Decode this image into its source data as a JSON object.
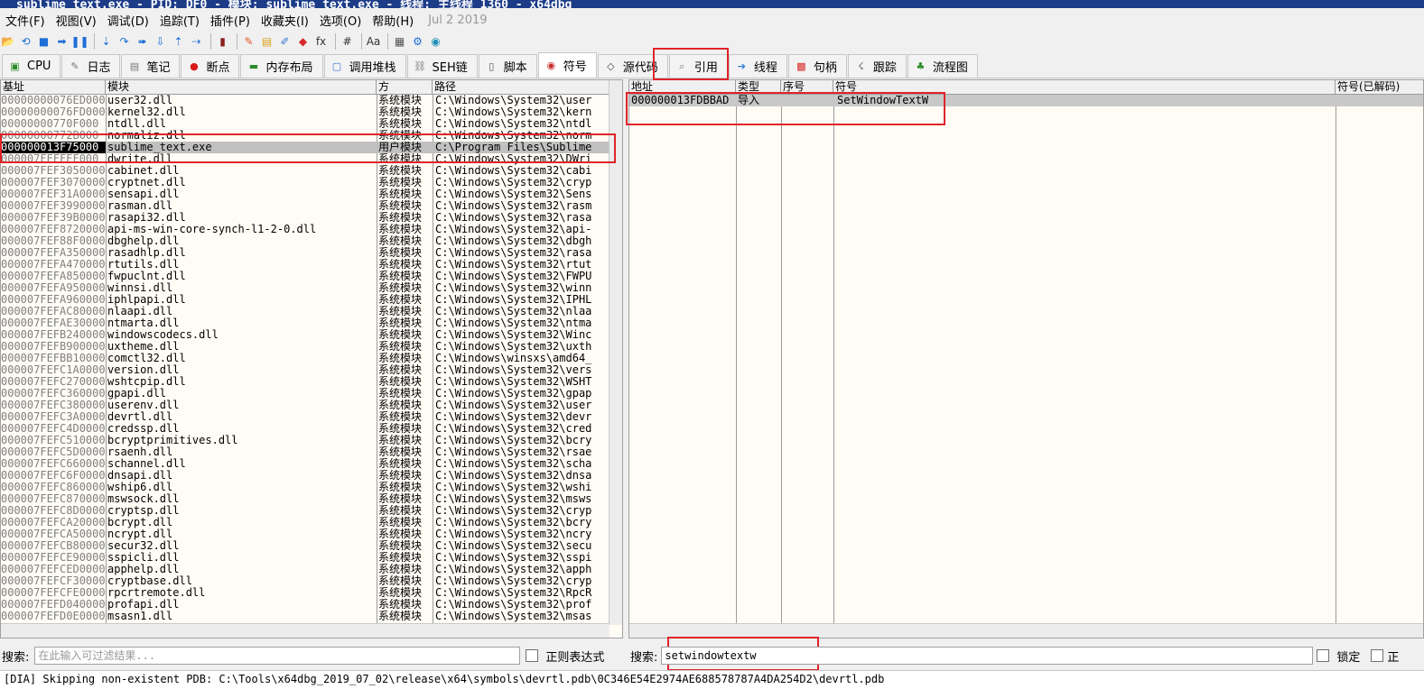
{
  "window": {
    "title": "sublime_text.exe - PID: DF0 - 模块: sublime_text.exe - 线程: 主线程 1360 - x64dbg"
  },
  "menu": {
    "items": [
      "文件(F)",
      "视图(V)",
      "调试(D)",
      "追踪(T)",
      "插件(P)",
      "收藏夹(I)",
      "选项(O)",
      "帮助(H)"
    ],
    "date": "Jul 2 2019"
  },
  "toolbar_icons": [
    "open-icon",
    "restart-icon",
    "stop-icon",
    "run-icon",
    "pause-icon",
    "step-into-icon",
    "step-over-icon",
    "animate-into-icon",
    "animate-over-icon",
    "execute-till-return-icon",
    "run-to-user-code-icon",
    "scylla-icon",
    "patch-icon",
    "comment-icon",
    "label-icon",
    "bookmark-icon",
    "function-icon",
    "hash-icon",
    "strings-icon",
    "calculator-icon",
    "settings-icon",
    "globe-icon"
  ],
  "tabs": [
    {
      "label": "CPU",
      "icon": "cpu-icon"
    },
    {
      "label": "日志",
      "icon": "log-icon"
    },
    {
      "label": "笔记",
      "icon": "notes-icon"
    },
    {
      "label": "断点",
      "icon": "breakpoint-icon"
    },
    {
      "label": "内存布局",
      "icon": "memory-icon"
    },
    {
      "label": "调用堆栈",
      "icon": "callstack-icon"
    },
    {
      "label": "SEH链",
      "icon": "seh-icon"
    },
    {
      "label": "脚本",
      "icon": "script-icon"
    },
    {
      "label": "符号",
      "icon": "symbols-icon"
    },
    {
      "label": "源代码",
      "icon": "source-icon"
    },
    {
      "label": "引用",
      "icon": "references-icon"
    },
    {
      "label": "线程",
      "icon": "threads-icon"
    },
    {
      "label": "句柄",
      "icon": "handles-icon"
    },
    {
      "label": "跟踪",
      "icon": "trace-icon"
    },
    {
      "label": "流程图",
      "icon": "graph-icon"
    }
  ],
  "active_tab": "符号",
  "modules": {
    "headers": [
      "基址",
      "模块",
      "方",
      "路径"
    ],
    "rows": [
      [
        "00000000076ED000",
        "user32.dll",
        "系统模块",
        "C:\\Windows\\System32\\user"
      ],
      [
        "00000000076FD000",
        "kernel32.dll",
        "系统模块",
        "C:\\Windows\\System32\\kern"
      ],
      [
        "00000000770F000",
        "ntdll.dll",
        "系统模块",
        "C:\\Windows\\System32\\ntdl"
      ],
      [
        "00000000772B000",
        "normaliz.dll",
        "系统模块",
        "C:\\Windows\\System32\\norm"
      ],
      [
        "000000013F75000",
        "sublime_text.exe",
        "用户模块",
        "C:\\Program Files\\Sublime"
      ],
      [
        "000007FEFFEF000",
        "dwrite.dll",
        "系统模块",
        "C:\\Windows\\System32\\DWri"
      ],
      [
        "000007FEF3050000",
        "cabinet.dll",
        "系统模块",
        "C:\\Windows\\System32\\cabi"
      ],
      [
        "000007FEF3070000",
        "cryptnet.dll",
        "系统模块",
        "C:\\Windows\\System32\\cryp"
      ],
      [
        "000007FEF31A0000",
        "sensapi.dll",
        "系统模块",
        "C:\\Windows\\System32\\Sens"
      ],
      [
        "000007FEF3990000",
        "rasman.dll",
        "系统模块",
        "C:\\Windows\\System32\\rasm"
      ],
      [
        "000007FEF39B0000",
        "rasapi32.dll",
        "系统模块",
        "C:\\Windows\\System32\\rasa"
      ],
      [
        "000007FEF8720000",
        "api-ms-win-core-synch-l1-2-0.dll",
        "系统模块",
        "C:\\Windows\\System32\\api-"
      ],
      [
        "000007FEF88F0000",
        "dbghelp.dll",
        "系统模块",
        "C:\\Windows\\System32\\dbgh"
      ],
      [
        "000007FEFA350000",
        "rasadhlp.dll",
        "系统模块",
        "C:\\Windows\\System32\\rasa"
      ],
      [
        "000007FEFA470000",
        "rtutils.dll",
        "系统模块",
        "C:\\Windows\\System32\\rtut"
      ],
      [
        "000007FEFA850000",
        "fwpuclnt.dll",
        "系统模块",
        "C:\\Windows\\System32\\FWPU"
      ],
      [
        "000007FEFA950000",
        "winnsi.dll",
        "系统模块",
        "C:\\Windows\\System32\\winn"
      ],
      [
        "000007FEFA960000",
        "iphlpapi.dll",
        "系统模块",
        "C:\\Windows\\System32\\IPHL"
      ],
      [
        "000007FEFAC80000",
        "nlaapi.dll",
        "系统模块",
        "C:\\Windows\\System32\\nlaa"
      ],
      [
        "000007FEFAE30000",
        "ntmarta.dll",
        "系统模块",
        "C:\\Windows\\System32\\ntma"
      ],
      [
        "000007FEFB240000",
        "windowscodecs.dll",
        "系统模块",
        "C:\\Windows\\System32\\Winc"
      ],
      [
        "000007FEFB900000",
        "uxtheme.dll",
        "系统模块",
        "C:\\Windows\\System32\\uxth"
      ],
      [
        "000007FEFBB10000",
        "comctl32.dll",
        "系统模块",
        "C:\\Windows\\winsxs\\amd64_"
      ],
      [
        "000007FEFC1A0000",
        "version.dll",
        "系统模块",
        "C:\\Windows\\System32\\vers"
      ],
      [
        "000007FEFC2700000",
        "wshtcpip.dll",
        "系统模块",
        "C:\\Windows\\System32\\WSHT"
      ],
      [
        "000007FEFC360000",
        "gpapi.dll",
        "系统模块",
        "C:\\Windows\\System32\\gpap"
      ],
      [
        "000007FEFC380000",
        "userenv.dll",
        "系统模块",
        "C:\\Windows\\System32\\user"
      ],
      [
        "000007FEFC3A0000",
        "devrtl.dll",
        "系统模块",
        "C:\\Windows\\System32\\devr"
      ],
      [
        "000007FEFC4D0000",
        "credssp.dll",
        "系统模块",
        "C:\\Windows\\System32\\cred"
      ],
      [
        "000007FEFC510000",
        "bcryptprimitives.dll",
        "系统模块",
        "C:\\Windows\\System32\\bcry"
      ],
      [
        "000007FEFC5D0000",
        "rsaenh.dll",
        "系统模块",
        "C:\\Windows\\System32\\rsae"
      ],
      [
        "000007FEFC660000",
        "schannel.dll",
        "系统模块",
        "C:\\Windows\\System32\\scha"
      ],
      [
        "000007FEFC6F0000",
        "dnsapi.dll",
        "系统模块",
        "C:\\Windows\\System32\\dnsa"
      ],
      [
        "000007FEFC860000",
        "wship6.dll",
        "系统模块",
        "C:\\Windows\\System32\\wshi"
      ],
      [
        "000007FEFC870000",
        "mswsock.dll",
        "系统模块",
        "C:\\Windows\\System32\\msws"
      ],
      [
        "000007FEFC8D0000",
        "cryptsp.dll",
        "系统模块",
        "C:\\Windows\\System32\\cryp"
      ],
      [
        "000007FEFCA20000",
        "bcrypt.dll",
        "系统模块",
        "C:\\Windows\\System32\\bcry"
      ],
      [
        "000007FEFCA50000",
        "ncrypt.dll",
        "系统模块",
        "C:\\Windows\\System32\\ncry"
      ],
      [
        "000007FEFCB80000",
        "secur32.dll",
        "系统模块",
        "C:\\Windows\\System32\\secu"
      ],
      [
        "000007FEFCE90000",
        "sspicli.dll",
        "系统模块",
        "C:\\Windows\\System32\\sspi"
      ],
      [
        "000007FEFCED0000",
        "apphelp.dll",
        "系统模块",
        "C:\\Windows\\System32\\apph"
      ],
      [
        "000007FEFCF30000",
        "cryptbase.dll",
        "系统模块",
        "C:\\Windows\\System32\\cryp"
      ],
      [
        "000007FEFCFE0000",
        "rpcrtremote.dll",
        "系统模块",
        "C:\\Windows\\System32\\RpcR"
      ],
      [
        "000007FEFD040000",
        "profapi.dll",
        "系统模块",
        "C:\\Windows\\System32\\prof"
      ],
      [
        "000007FEFD0E0000",
        "msasn1.dll",
        "系统模块",
        "C:\\Windows\\System32\\msas"
      ]
    ],
    "selected_index": 4
  },
  "symbols": {
    "headers": [
      "地址",
      "类型",
      "序号",
      "符号",
      "符号(已解码)"
    ],
    "rows": [
      [
        "000000013FDBBAD",
        "导入",
        "",
        "SetWindowTextW",
        ""
      ]
    ]
  },
  "search_left": {
    "label": "搜索:",
    "placeholder": "在此输入可过滤结果...",
    "regex_label": "正则表达式"
  },
  "search_right": {
    "label": "搜索:",
    "value": "setwindowtextw",
    "lock_label": "锁定",
    "extra_label": "正"
  },
  "status": "[DIA] Skipping non-existent PDB: C:\\Tools\\x64dbg_2019_07_02\\release\\x64\\symbols\\devrtl.pdb\\0C346E54E2974AE688578787A4DA254D2\\devrtl.pdb"
}
